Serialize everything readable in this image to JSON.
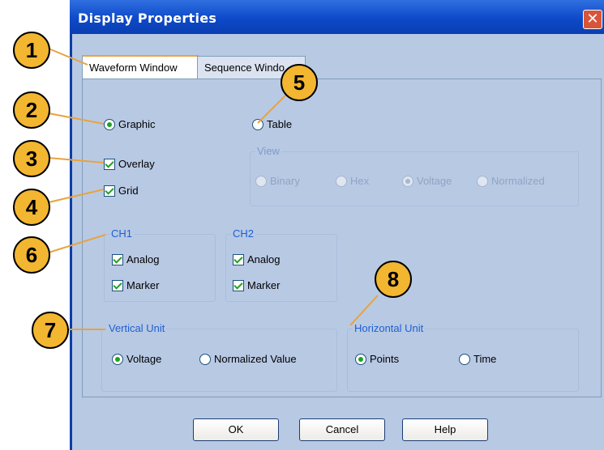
{
  "window": {
    "title": "Display Properties",
    "close_glyph": "✕"
  },
  "tabs": [
    {
      "label": "Waveform Window",
      "active": true
    },
    {
      "label": "Sequence Windo",
      "active": false
    }
  ],
  "display_mode": {
    "graphic_label": "Graphic",
    "graphic_selected": true,
    "table_label": "Table",
    "table_selected": false
  },
  "options": {
    "overlay_label": "Overlay",
    "overlay_checked": true,
    "grid_label": "Grid",
    "grid_checked": true
  },
  "view": {
    "title": "View",
    "items": [
      {
        "label": "Binary",
        "selected": false
      },
      {
        "label": "Hex",
        "selected": false
      },
      {
        "label": "Voltage",
        "selected": true
      },
      {
        "label": "Normalized",
        "selected": false
      }
    ]
  },
  "ch1": {
    "title": "CH1",
    "analog_label": "Analog",
    "marker_label": "Marker"
  },
  "ch2": {
    "title": "CH2",
    "analog_label": "Analog",
    "marker_label": "Marker"
  },
  "vertical_unit": {
    "title": "Vertical Unit",
    "voltage_label": "Voltage",
    "voltage_selected": true,
    "normalized_label": "Normalized Value",
    "normalized_selected": false
  },
  "horizontal_unit": {
    "title": "Horizontal Unit",
    "points_label": "Points",
    "points_selected": true,
    "time_label": "Time",
    "time_selected": false
  },
  "buttons": {
    "ok": "OK",
    "cancel": "Cancel",
    "help": "Help"
  },
  "callouts": [
    "1",
    "2",
    "3",
    "4",
    "5",
    "6",
    "7",
    "8"
  ],
  "colors": {
    "callout_fill": "#f2b630",
    "titlebar": "#0d49c9",
    "dialog_bg": "#b8c9e4",
    "group_title": "#1f5fcf",
    "check_mark": "#21a121"
  }
}
